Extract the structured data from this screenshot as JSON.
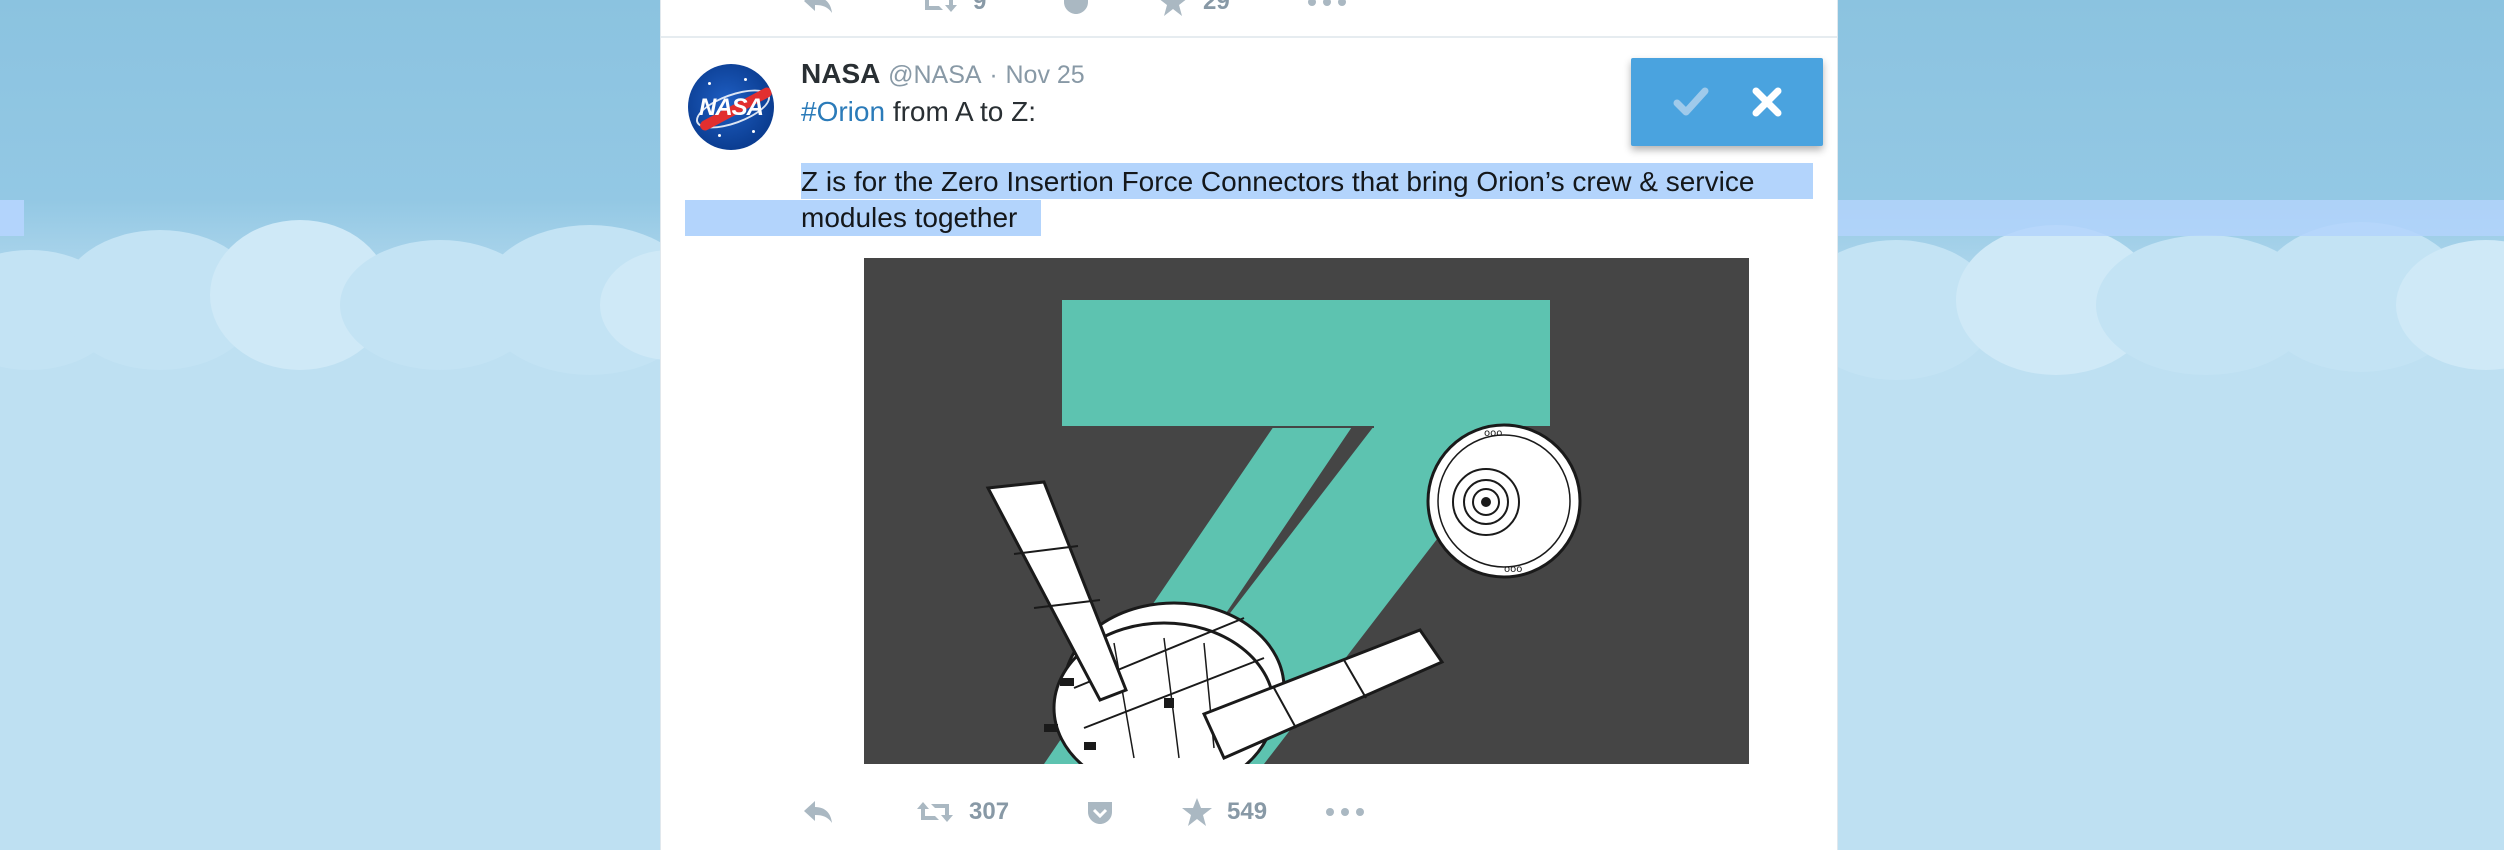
{
  "tweet": {
    "display_name": "NASA",
    "handle": "@NASA",
    "dot": "·",
    "time": "Nov 25",
    "line1_hashtag": "#Orion",
    "line1_rest": " from A to Z:",
    "body": "Z is for the Zero Insertion Force Connectors that bring Orion’s crew & service modules together",
    "avatar_text": "NASA",
    "media_alt_icon": "letter-z-with-orion-spacecraft",
    "actions": {
      "reply_icon": "reply-icon",
      "retweet_count": "307",
      "like_count": "549",
      "more_icon": "more-icon"
    }
  },
  "previous_tweet_actions": {
    "retweet_count": "9",
    "like_count": "29"
  },
  "popover": {
    "confirm_icon": "check-icon",
    "cancel_icon": "close-icon"
  },
  "colors": {
    "link": "#2b7bb9",
    "selection": "#b3d4fc",
    "popover": "#4aa3df",
    "teal": "#5dc3b0",
    "media_bg": "#454545"
  }
}
